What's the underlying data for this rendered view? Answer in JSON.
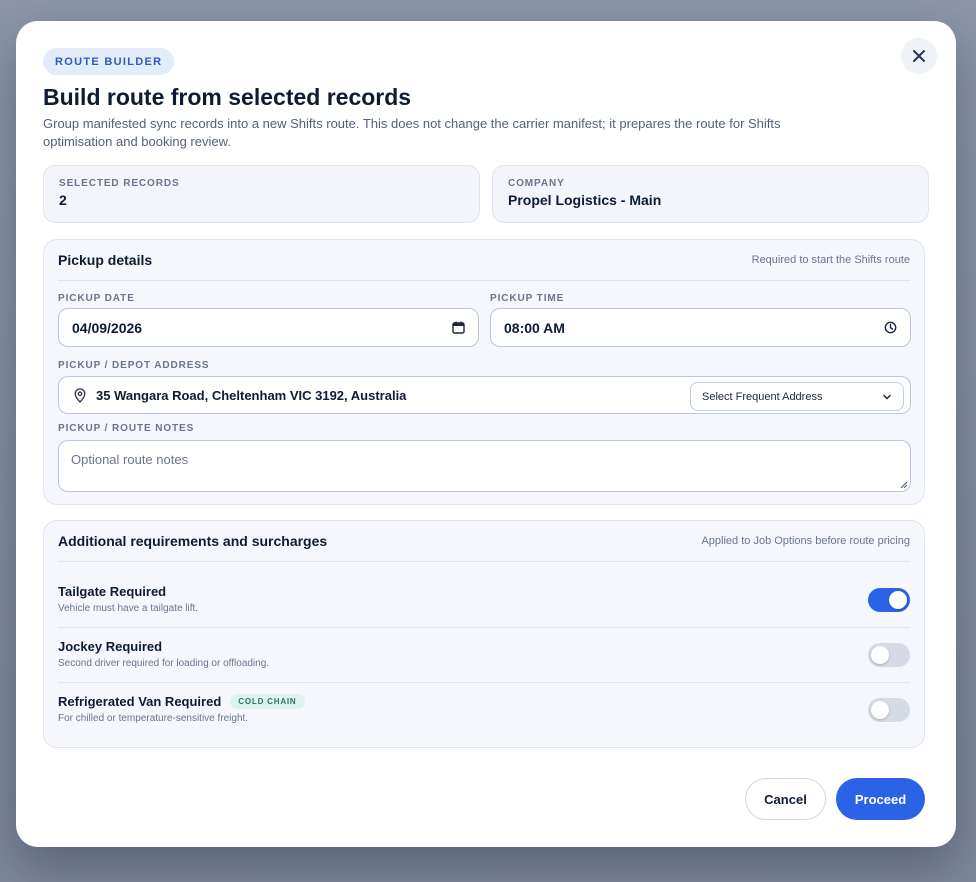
{
  "modal": {
    "badge": "ROUTE BUILDER",
    "title": "Build route from selected records",
    "subtitle": "Group manifested sync records into a new Shifts route. This does not change the carrier manifest; it prepares the route for Shifts optimisation and booking review."
  },
  "summary": {
    "selected_label": "SELECTED RECORDS",
    "selected_value": "2",
    "company_label": "COMPANY",
    "company_value": "Propel Logistics - Main"
  },
  "pickup": {
    "title": "Pickup details",
    "note": "Required to start the Shifts route",
    "date_label": "PICKUP DATE",
    "date_value": "04/09/2026",
    "time_label": "PICKUP TIME",
    "time_value": "08:00 AM",
    "address_label": "PICKUP / DEPOT ADDRESS",
    "address_value": "35 Wangara Road, Cheltenham VIC 3192, Australia",
    "frequent_select": "Select Frequent Address",
    "notes_label": "PICKUP / ROUTE NOTES",
    "notes_placeholder": "Optional route notes"
  },
  "requirements": {
    "title": "Additional requirements and surcharges",
    "note": "Applied to Job Options before route pricing",
    "items": [
      {
        "name": "Tailgate Required",
        "desc": "Vehicle must have a tailgate lift.",
        "enabled": true
      },
      {
        "name": "Jockey Required",
        "desc": "Second driver required for loading or offloading.",
        "enabled": false
      },
      {
        "name": "Refrigerated Van Required",
        "desc": "For chilled or temperature-sensitive freight.",
        "enabled": false,
        "tag": "COLD CHAIN"
      }
    ]
  },
  "actions": {
    "cancel": "Cancel",
    "proceed": "Proceed"
  },
  "colors": {
    "accent": "#2b63e6",
    "tag_bg": "#dff3ee",
    "tag_text": "#1e7a63"
  }
}
